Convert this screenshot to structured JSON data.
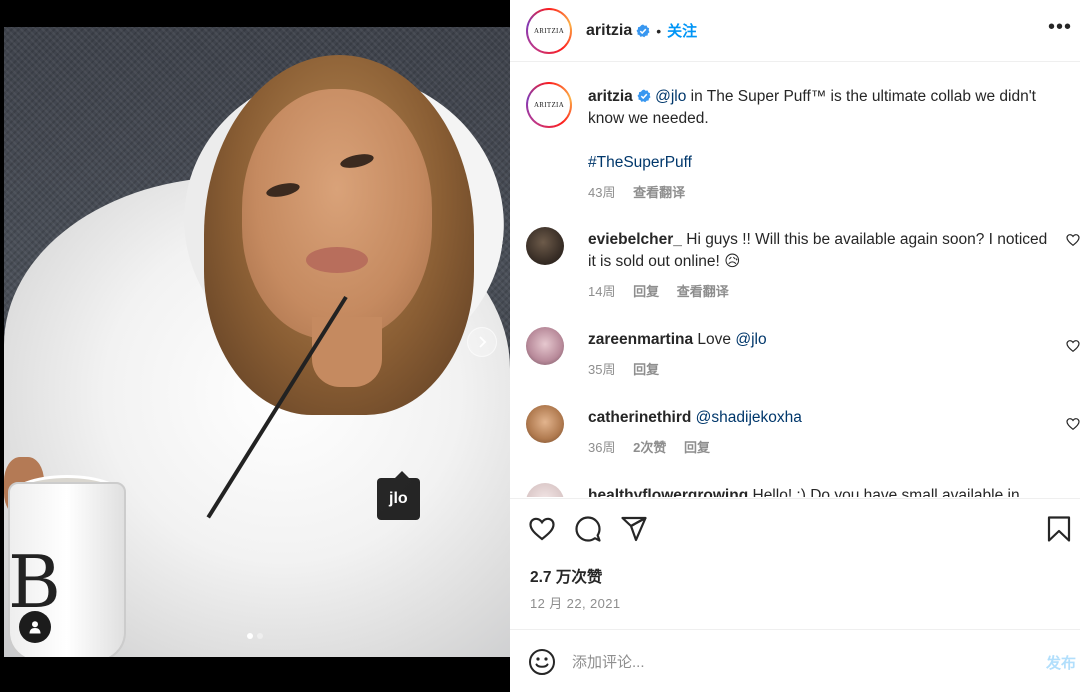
{
  "post": {
    "username": "aritzia",
    "avatar_text": "ARITZIA",
    "separator": "•",
    "follow_label": "关注",
    "more_label": "•••"
  },
  "photo": {
    "tag_label": "jlo",
    "carousel_total": 2,
    "carousel_active": 1,
    "mug_letter": "B"
  },
  "caption": {
    "username": "aritzia",
    "mention": "@jlo",
    "text": " in The Super Puff™ is the ultimate collab we didn't know we needed.",
    "hashtag": "#TheSuperPuff",
    "time": "43周",
    "translate": "查看翻译"
  },
  "comments": [
    {
      "username": "eviebelcher_",
      "text": " Hi guys !! Will this be available again soon? I noticed it is sold out online! 😥",
      "time": "14周",
      "reply": "回复",
      "translate": "查看翻译"
    },
    {
      "username": "zareenmartina",
      "text": " Love ",
      "mention": "@jlo",
      "time": "35周",
      "reply": "回复"
    },
    {
      "username": "catherinethird",
      "mention": "@shadijekoxha",
      "time": "36周",
      "likes": "2次赞",
      "reply": "回复"
    },
    {
      "username": "healthyflowergrowing",
      "text": " Hello! :) Do you have small available in"
    }
  ],
  "footer": {
    "likes": "2.7 万次赞",
    "date": "12 月 22, 2021",
    "comment_placeholder": "添加评论...",
    "post_label": "发布"
  },
  "colors": {
    "accent": "#0095f6",
    "link": "#00376b",
    "muted": "#8e8e8e",
    "post_disabled": "#b2dffc"
  }
}
